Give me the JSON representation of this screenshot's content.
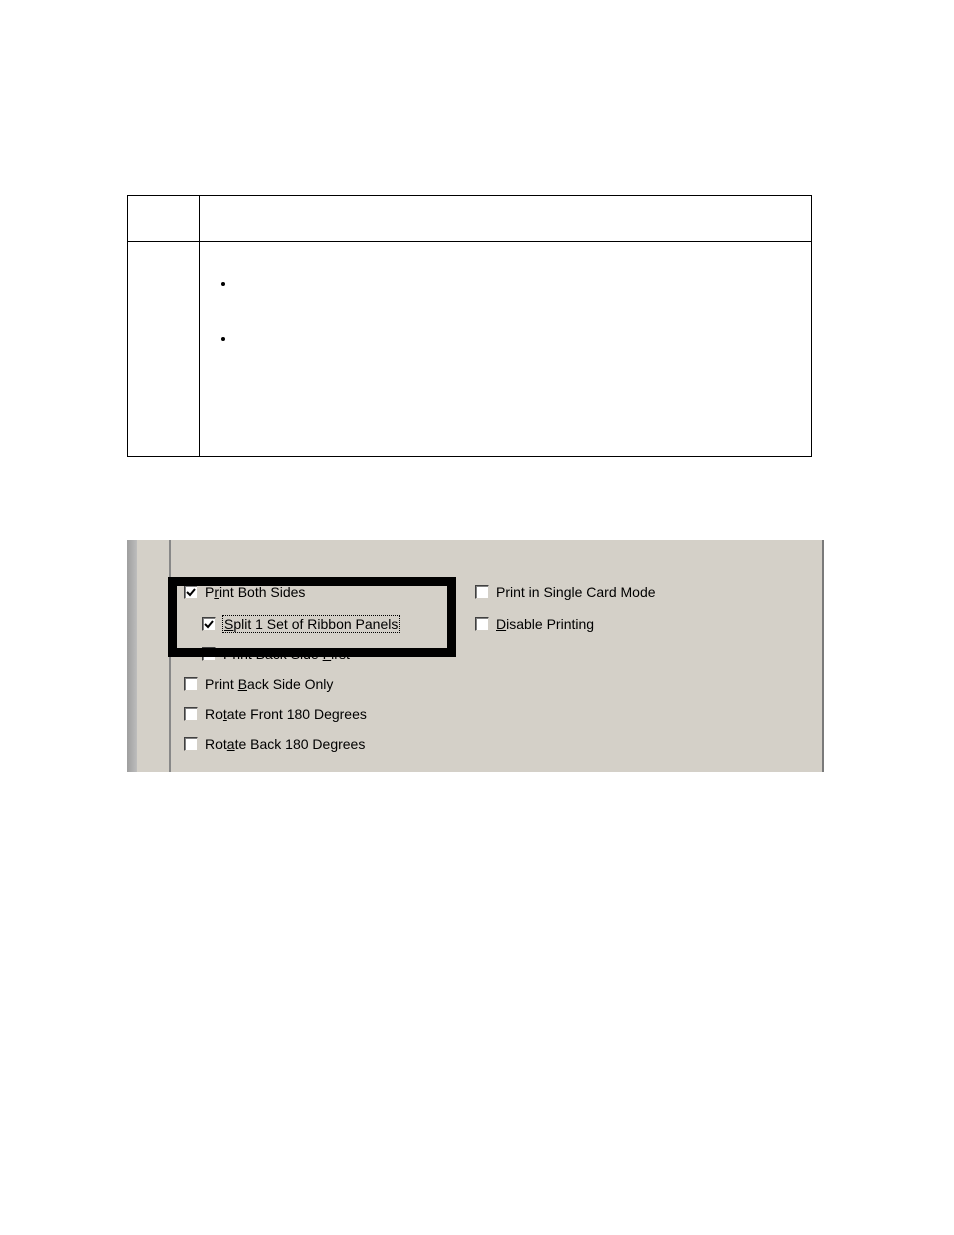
{
  "table": {
    "bullet1": " ",
    "bullet2": " "
  },
  "options": {
    "print_both_sides": {
      "label_pre": "P",
      "label_u": "r",
      "label_post": "int Both Sides",
      "checked": true
    },
    "split_panels": {
      "label_pre": "",
      "label_u": "S",
      "label_post": "plit 1 Set of Ribbon Panels",
      "checked": true
    },
    "print_back_first": {
      "label_pre": "Print Back Side ",
      "label_u": "F",
      "label_post": "irst",
      "checked": false
    },
    "print_back_only": {
      "label_pre": "Print ",
      "label_u": "B",
      "label_post": "ack Side Only",
      "checked": false
    },
    "rotate_front": {
      "label_pre": "Ro",
      "label_u": "t",
      "label_post": "ate Front 180 Degrees",
      "checked": false
    },
    "rotate_back": {
      "label_pre": "Rot",
      "label_u": "a",
      "label_post": "te Back 180 Degrees",
      "checked": false
    },
    "single_card": {
      "label_pre": "Print in Single Card Mode",
      "label_u": "",
      "label_post": "",
      "checked": false
    },
    "disable_printing": {
      "label_pre": "",
      "label_u": "D",
      "label_post": "isable Printing",
      "checked": false
    }
  }
}
